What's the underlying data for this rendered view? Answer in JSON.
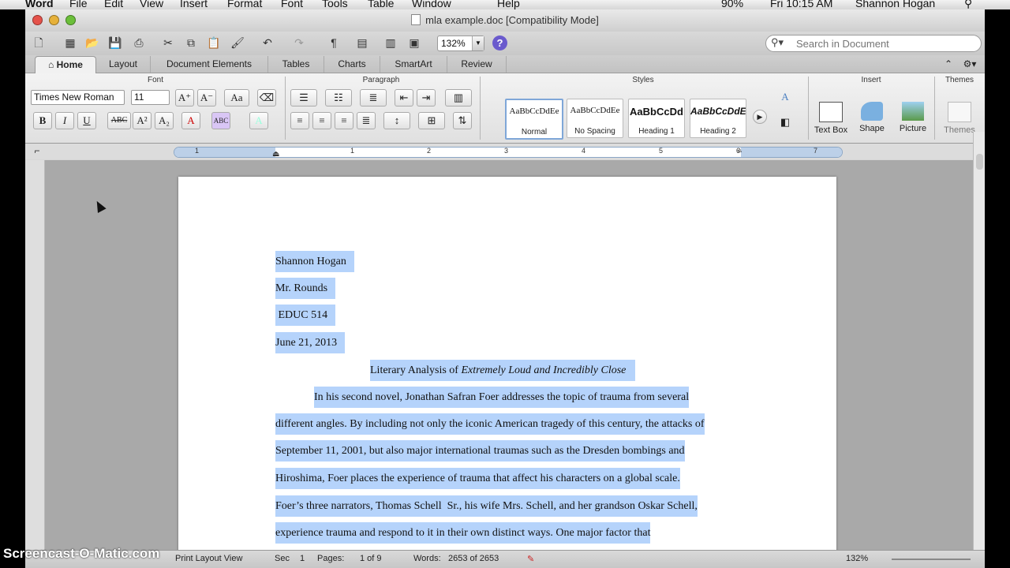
{
  "menubar": {
    "app": "Word",
    "items": [
      "File",
      "Edit",
      "View",
      "Insert",
      "Format",
      "Font",
      "Tools",
      "Table",
      "Window",
      "Help"
    ],
    "battery": "90%",
    "clock": "Fri 10:15 AM",
    "user": "Shannon Hogan"
  },
  "window": {
    "title": "mla example.doc [Compatibility Mode]"
  },
  "toolbar": {
    "zoom": "132%",
    "search_placeholder": "Search in Document"
  },
  "tabs": [
    "Home",
    "Layout",
    "Document Elements",
    "Tables",
    "Charts",
    "SmartArt",
    "Review"
  ],
  "ribbon": {
    "groups": {
      "font": "Font",
      "paragraph": "Paragraph",
      "styles": "Styles",
      "insert": "Insert",
      "themes": "Themes"
    },
    "font_name": "Times New Roman",
    "font_size": "11",
    "format_buttons": [
      "B",
      "I",
      "U",
      "ABC",
      "A²",
      "A₂"
    ],
    "styles": [
      {
        "preview": "AaBbCcDdEe",
        "name": "Normal"
      },
      {
        "preview": "AaBbCcDdEe",
        "name": "No Spacing"
      },
      {
        "preview": "AaBbCcDd",
        "name": "Heading 1"
      },
      {
        "preview": "AaBbCcDdE",
        "name": "Heading 2"
      }
    ],
    "insert_items": [
      "Text Box",
      "Shape",
      "Picture"
    ],
    "themes_label": "Themes"
  },
  "ruler": {
    "numbers": [
      "1",
      "1",
      "2",
      "3",
      "4",
      "5",
      "6",
      "7"
    ]
  },
  "document": {
    "header_lines": [
      "Shannon Hogan",
      "Mr. Rounds",
      " EDUC 514",
      "June 21, 2013"
    ],
    "title_plain": "Literary Analysis of ",
    "title_italic": "Extremely Loud and Incredibly Close",
    "body": [
      "In his second novel, Jonathan Safran Foer addresses the topic of trauma from several",
      "different angles. By including not only the iconic American tragedy of this century, the attacks of",
      "September 11, 2001, but also major international traumas such as the Dresden bombings and",
      "Hiroshima, Foer places the experience of trauma that affect his characters on a global scale.",
      "Foer’s three narrators, Thomas Schell  Sr., his wife Mrs. Schell, and her grandson Oskar Schell,",
      "experience trauma and respond to it in their own distinct ways. One major factor that"
    ]
  },
  "status": {
    "view": "Print Layout View",
    "sec_label": "Sec",
    "sec_value": "1",
    "pages_label": "Pages:",
    "pages_value": "1 of 9",
    "words_label": "Words:",
    "words_value": "2653 of 2653",
    "zoom": "132%"
  },
  "watermark": "Screencast-O-Matic.com",
  "colors": {
    "selection": "#b5d3fb",
    "accent": "#7fa7d8",
    "close": "#e5524a",
    "minimize": "#e6b13a",
    "zoom": "#6bbf3a"
  }
}
